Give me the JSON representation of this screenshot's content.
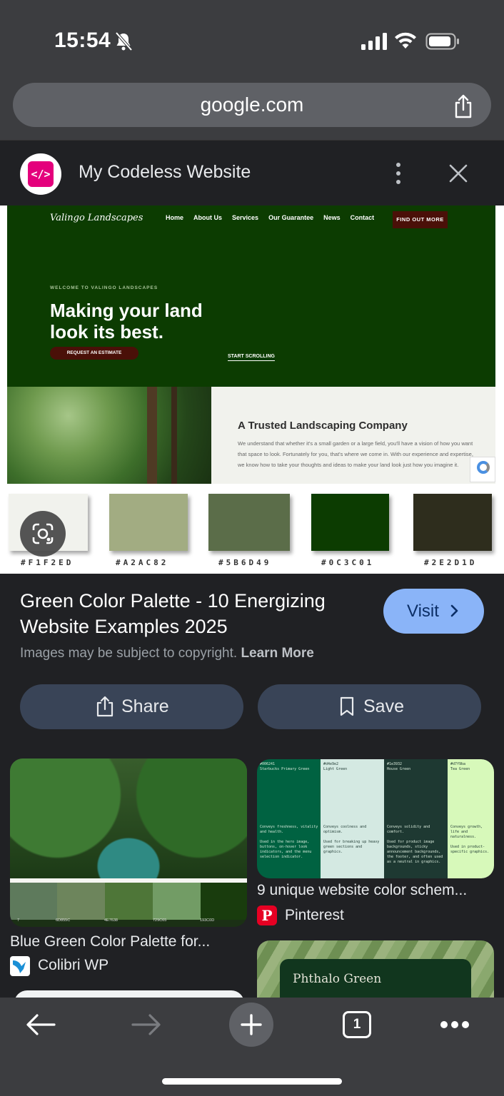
{
  "status": {
    "time": "15:54"
  },
  "browser": {
    "url": "google.com"
  },
  "lens": {
    "site_favicon": "</>",
    "site_name": "My Codeless Website"
  },
  "preview": {
    "logo": "Valingo Landscapes",
    "nav": [
      "Home",
      "About Us",
      "Services",
      "Our Guarantee",
      "News",
      "Contact"
    ],
    "cta": "FIND OUT MORE",
    "welcome": "WELCOME TO VALINGO LANDSCAPES",
    "headline": "Making your land look its best.",
    "estimate_button": "REQUEST AN ESTIMATE",
    "scroll_link": "START SCROLLING",
    "section_title": "A Trusted Landscaping Company",
    "section_body": "We understand that whether it's a small garden or a large field, you'll have a vision of how you want that space to look. Fortunately for you, that's where we come in. With our experience and expertise, we know how to take your thoughts and ideas to make your land look just how you imagine it.",
    "swatches": [
      {
        "label": "#F1F2ED",
        "color": "#F1F2ED"
      },
      {
        "label": "#A2AC82",
        "color": "#A2AC82"
      },
      {
        "label": "#5B6D49",
        "color": "#5B6D49"
      },
      {
        "label": "#0C3C01",
        "color": "#0C3C01"
      },
      {
        "label": "#2E2D1D",
        "color": "#2E2D1D"
      }
    ]
  },
  "result": {
    "title": "Green Color Palette - 10 Energizing Website Examples 2025",
    "visit_label": "Visit",
    "copyright_text": "Images may be subject to copyright.",
    "learn_more": "Learn More",
    "share_label": "Share",
    "save_label": "Save"
  },
  "related": [
    {
      "caption": "Blue Green Color Palette for...",
      "source": "Colibri WP",
      "swatches": [
        {
          "label": "7",
          "color": "#5e7a5c"
        },
        {
          "label": "6D855C",
          "color": "#6d855c"
        },
        {
          "label": "4E7638",
          "color": "#4e7638"
        },
        {
          "label": "729C65",
          "color": "#729c65"
        },
        {
          "label": "193C0D",
          "color": "#193c0d"
        }
      ]
    },
    {
      "caption": "9 unique website color schem...",
      "source": "Pinterest",
      "columns": [
        {
          "hex": "#006241",
          "name": "Starbucks Primary Green",
          "desc": "Conveys freshness, vitality and health.",
          "use": "Used in the hero image, buttons, on-hover look indicators, and the menu selection indicator.",
          "bg": "#006241",
          "fg": "#d8eadb"
        },
        {
          "hex": "#d4e9e2",
          "name": "Light Green",
          "desc": "Conveys coolness and optimism.",
          "use": "Used for breaking up heavy green sections and graphics.",
          "bg": "#d4e9e2",
          "fg": "#1e3932"
        },
        {
          "hex": "#1e3932",
          "name": "House Green",
          "desc": "Conveys solidity and comfort.",
          "use": "Used for product image backgrounds, sticky announcement backgrounds, the footer, and often used as a neutral in graphics.",
          "bg": "#1e3932",
          "fg": "#d8eadb"
        },
        {
          "hex": "#d7f9ba",
          "name": "Tea Green",
          "desc": "Conveys growth, life and naturalness.",
          "use": "Used in product-specific graphics.",
          "bg": "#d7f9ba",
          "fg": "#1e3932"
        }
      ]
    },
    {
      "caption_partial": "Phthalo Green"
    }
  ],
  "toolbar": {
    "tab_count": "1"
  }
}
